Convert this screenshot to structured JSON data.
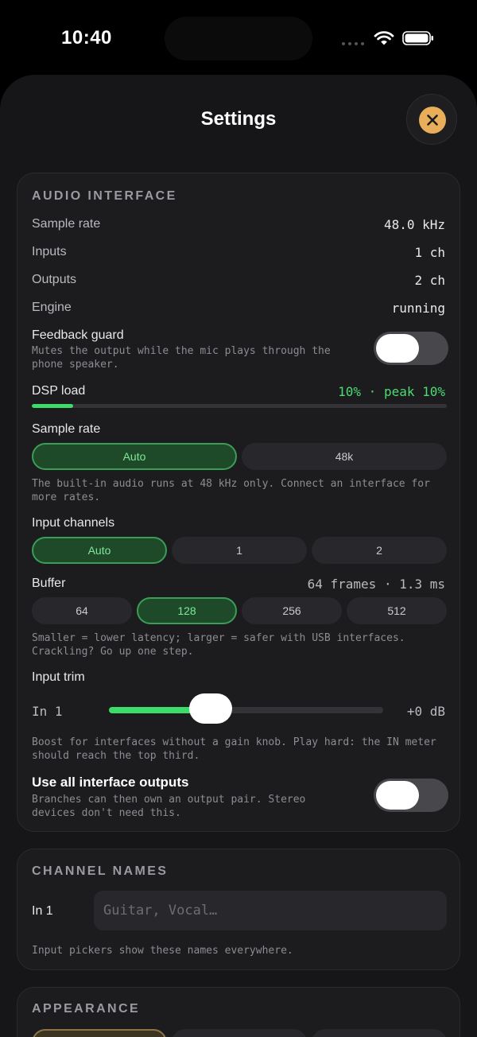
{
  "status_bar": {
    "time": "10:40"
  },
  "sheet": {
    "title": "Settings"
  },
  "audio_interface": {
    "heading": "AUDIO INTERFACE",
    "sample_rate": {
      "label": "Sample rate",
      "value": "48.0 kHz"
    },
    "inputs": {
      "label": "Inputs",
      "value": "1 ch"
    },
    "outputs": {
      "label": "Outputs",
      "value": "2 ch"
    },
    "engine": {
      "label": "Engine",
      "value": "running"
    },
    "feedback_guard": {
      "label": "Feedback guard",
      "hint": "Mutes the output while the mic plays through the phone speaker.",
      "on": false
    },
    "dsp_load": {
      "label": "DSP load",
      "value": "10% · peak 10%",
      "level": 0.1
    },
    "sample_rate_select": {
      "label": "Sample rate",
      "options": [
        "Auto",
        "48k"
      ],
      "selected": "Auto",
      "hint": "The built-in audio runs at 48 kHz only. Connect an interface for more rates."
    },
    "input_channels": {
      "label": "Input channels",
      "options": [
        "Auto",
        "1",
        "2"
      ],
      "selected": "Auto"
    },
    "buffer": {
      "label": "Buffer",
      "value": "64 frames · 1.3 ms",
      "options": [
        "64",
        "128",
        "256",
        "512"
      ],
      "selected": "128",
      "hint": "Smaller = lower latency; larger = safer with USB interfaces. Crackling? Go up one step."
    },
    "input_trim": {
      "label": "Input trim",
      "channel": "In 1",
      "value": "+0 dB",
      "level": 0.37,
      "hint": "Boost for interfaces without a gain knob. Play hard: the IN meter should reach the top third."
    },
    "use_all_outputs": {
      "label": "Use all interface outputs",
      "hint": "Branches can then own an output pair. Stereo devices don't need this.",
      "on": false
    }
  },
  "channel_names": {
    "heading": "CHANNEL NAMES",
    "channel": "In 1",
    "placeholder": "Guitar, Vocal…",
    "hint": "Input pickers show these names everywhere."
  },
  "appearance": {
    "heading": "APPEARANCE"
  },
  "colors": {
    "accent_green": "#3ddc6a",
    "close_button": "#e9ae5a"
  }
}
